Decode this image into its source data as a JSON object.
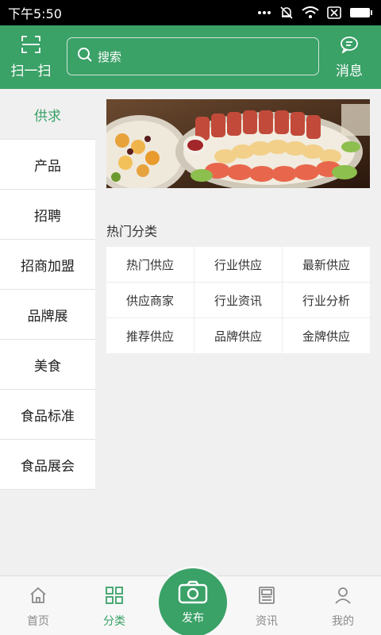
{
  "status_bar": {
    "time": "下午5:50"
  },
  "header": {
    "scan_label": "扫一扫",
    "search_placeholder": "搜索",
    "message_label": "消息"
  },
  "sidebar": {
    "items": [
      {
        "label": "供求",
        "active": true
      },
      {
        "label": "产品"
      },
      {
        "label": "招聘"
      },
      {
        "label": "招商加盟"
      },
      {
        "label": "品牌展"
      },
      {
        "label": "美食"
      },
      {
        "label": "食品标准"
      },
      {
        "label": "食品展会"
      }
    ]
  },
  "categories": {
    "title": "热门分类",
    "items": [
      "热门供应",
      "行业供应",
      "最新供应",
      "供应商家",
      "行业资讯",
      "行业分析",
      "推荐供应",
      "品牌供应",
      "金牌供应"
    ]
  },
  "bottom_nav": {
    "items": [
      {
        "label": "首页",
        "icon": "home-icon"
      },
      {
        "label": "分类",
        "icon": "grid-icon",
        "active": true
      },
      {
        "label": "发布",
        "icon": "camera-icon"
      },
      {
        "label": "资讯",
        "icon": "news-icon"
      },
      {
        "label": "我的",
        "icon": "user-icon"
      }
    ]
  },
  "colors": {
    "accent": "#3aa167",
    "background": "#f0f0f0"
  }
}
